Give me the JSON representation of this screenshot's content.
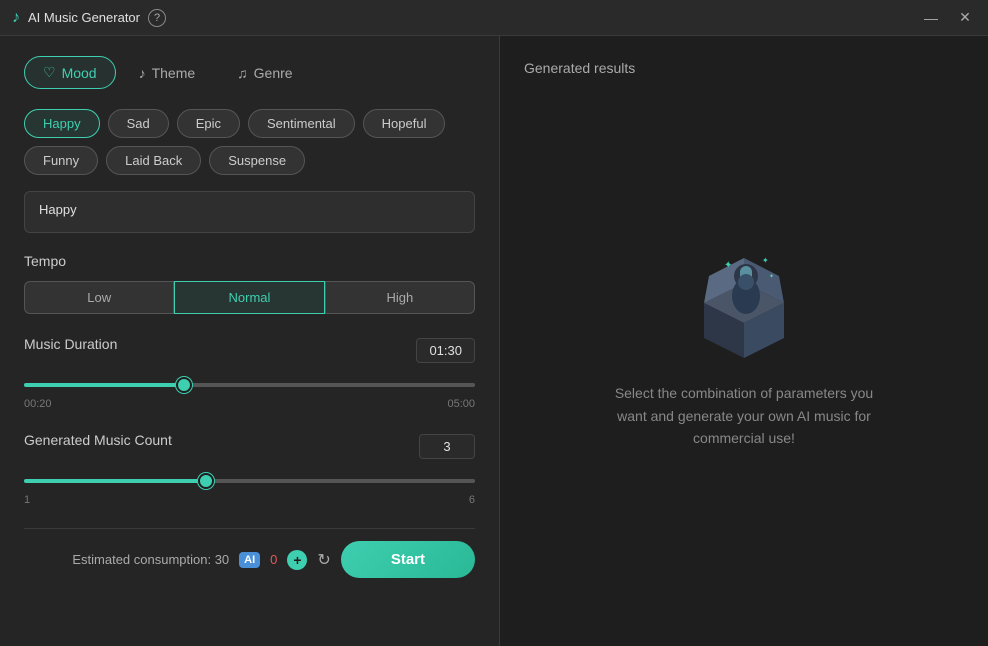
{
  "titleBar": {
    "title": "AI Music Generator",
    "minimizeLabel": "—",
    "closeLabel": "✕"
  },
  "tabs": [
    {
      "id": "mood",
      "label": "Mood",
      "icon": "♡",
      "active": true
    },
    {
      "id": "theme",
      "label": "Theme",
      "icon": "♪",
      "active": false
    },
    {
      "id": "genre",
      "label": "Genre",
      "icon": "♫",
      "active": false
    }
  ],
  "moodTags": [
    {
      "label": "Happy",
      "selected": true
    },
    {
      "label": "Sad",
      "selected": false
    },
    {
      "label": "Epic",
      "selected": false
    },
    {
      "label": "Sentimental",
      "selected": false
    },
    {
      "label": "Hopeful",
      "selected": false
    },
    {
      "label": "Funny",
      "selected": false
    },
    {
      "label": "Laid Back",
      "selected": false
    },
    {
      "label": "Suspense",
      "selected": false
    }
  ],
  "moodInputValue": "Happy",
  "tempo": {
    "label": "Tempo",
    "options": [
      "Low",
      "Normal",
      "High"
    ],
    "selected": "Normal"
  },
  "musicDuration": {
    "label": "Music Duration",
    "min": "00:20",
    "max": "05:00",
    "value": "01:30",
    "fillPercent": "35%",
    "sliderVal": 35
  },
  "musicCount": {
    "label": "Generated Music Count",
    "min": "1",
    "max": "6",
    "value": "3",
    "fillPercent": "40%",
    "sliderVal": 40
  },
  "bottomBar": {
    "consumptionLabel": "Estimated consumption: 30",
    "aiBadge": "AI",
    "tokenCount": "0",
    "startLabel": "Start"
  },
  "rightPanel": {
    "title": "Generated results",
    "description": "Select the combination of parameters you want and generate your own AI music for commercial use!"
  }
}
